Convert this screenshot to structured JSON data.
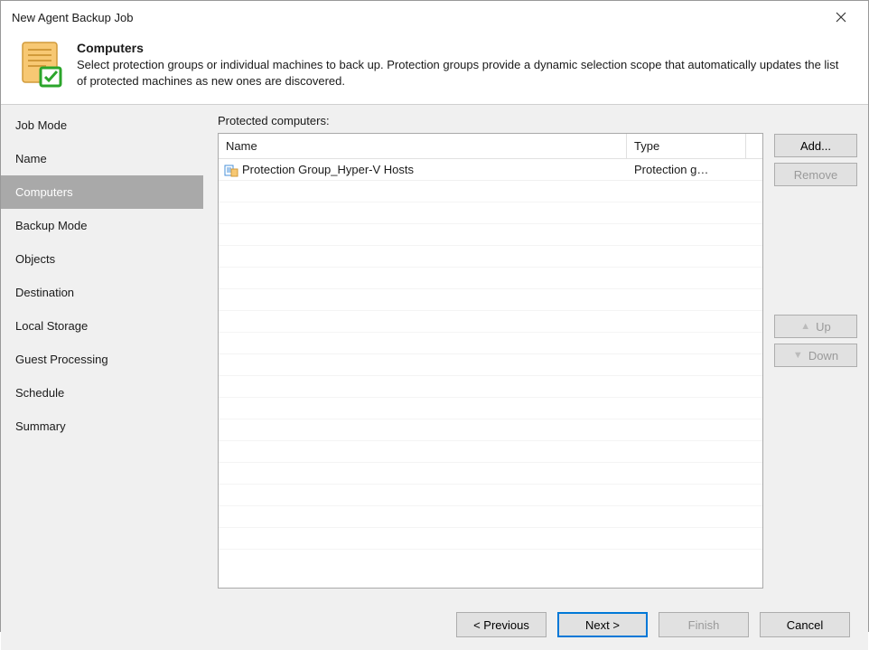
{
  "window": {
    "title": "New Agent Backup Job"
  },
  "header": {
    "title": "Computers",
    "description": "Select protection groups or individual machines to back up. Protection groups provide a dynamic selection scope that automatically updates the list of protected machines as new ones are discovered."
  },
  "sidebar": {
    "items": [
      {
        "label": "Job Mode",
        "active": false
      },
      {
        "label": "Name",
        "active": false
      },
      {
        "label": "Computers",
        "active": true
      },
      {
        "label": "Backup Mode",
        "active": false
      },
      {
        "label": "Objects",
        "active": false
      },
      {
        "label": "Destination",
        "active": false
      },
      {
        "label": "Local Storage",
        "active": false
      },
      {
        "label": "Guest Processing",
        "active": false
      },
      {
        "label": "Schedule",
        "active": false
      },
      {
        "label": "Summary",
        "active": false
      }
    ]
  },
  "table": {
    "label": "Protected computers:",
    "columns": {
      "name": "Name",
      "type": "Type"
    },
    "rows": [
      {
        "name": "Protection Group_Hyper-V Hosts",
        "type": "Protection g…"
      }
    ]
  },
  "buttons": {
    "add": "Add...",
    "remove": "Remove",
    "up": "Up",
    "down": "Down"
  },
  "footer": {
    "previous": "< Previous",
    "next": "Next >",
    "finish": "Finish",
    "cancel": "Cancel"
  }
}
